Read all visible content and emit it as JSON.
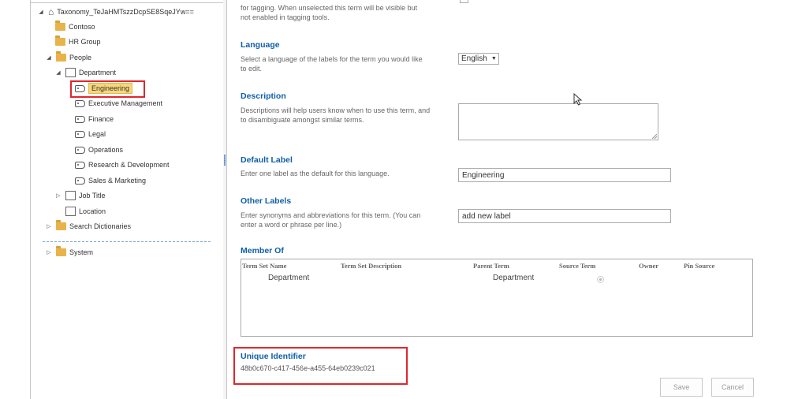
{
  "tree": {
    "root": "Taxonomy_TeJaHMTszzDcpSE8SqeJYw==",
    "items": [
      {
        "label": "Contoso"
      },
      {
        "label": "HR Group"
      },
      {
        "label": "People"
      },
      {
        "label": "Department"
      },
      {
        "label": "Engineering"
      },
      {
        "label": "Executive Management"
      },
      {
        "label": "Finance"
      },
      {
        "label": "Legal"
      },
      {
        "label": "Operations"
      },
      {
        "label": "Research & Development"
      },
      {
        "label": "Sales & Marketing"
      },
      {
        "label": "Job Title"
      },
      {
        "label": "Location"
      },
      {
        "label": "Search Dictionaries"
      },
      {
        "label": "System"
      }
    ]
  },
  "form": {
    "available_desc_top": "for tagging. When unselected this term will be visible but",
    "available_desc_bottom": "not enabled in tagging tools.",
    "language": {
      "title": "Language",
      "desc1": "Select a language of the labels for the term you would like",
      "desc2": "to edit.",
      "value": "English"
    },
    "description": {
      "title": "Description",
      "desc1": "Descriptions will help users know when to use this term, and",
      "desc2": "to disambiguate amongst similar terms."
    },
    "default_label": {
      "title": "Default Label",
      "desc1": "Enter one label as the default for this language.",
      "value": "Engineering"
    },
    "other_labels": {
      "title": "Other Labels",
      "desc1": "Enter synonyms and abbreviations for this term. (You can",
      "desc2": "enter a word or phrase per line.)",
      "placeholder": "add new label"
    },
    "member_of": {
      "title": "Member Of",
      "columns": [
        "Term Set Name",
        "Term Set Description",
        "Parent Term",
        "Source Term",
        "Owner",
        "Pin Source"
      ],
      "rows": [
        {
          "term_set_name": "Department",
          "term_set_description": "",
          "parent_term": "Department",
          "owner": "",
          "pin_source": ""
        }
      ]
    },
    "unique_identifier": {
      "title": "Unique Identifier",
      "value": "48b0c670-c417-456e-a455-64eb0239c021"
    },
    "buttons": {
      "save": "Save",
      "cancel": "Cancel"
    }
  },
  "colors": {
    "section_title": "#0f5fa8",
    "highlight_box": "#e0262d",
    "selected_node": "#f7d77a"
  }
}
